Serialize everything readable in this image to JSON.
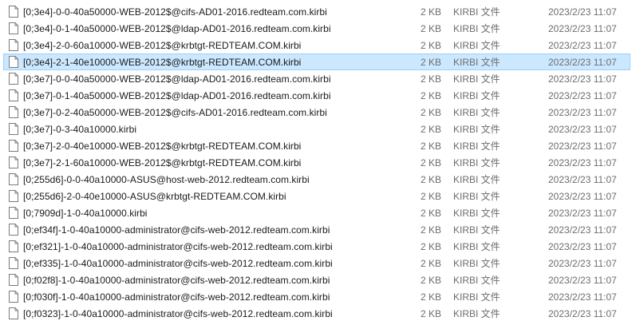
{
  "files": [
    {
      "name": "[0;3e4]-0-0-40a50000-WEB-2012$@cifs-AD01-2016.redteam.com.kirbi",
      "size": "2 KB",
      "type": "KIRBI 文件",
      "date": "2023/2/23 11:07",
      "icon": "document-icon"
    },
    {
      "name": "[0;3e4]-0-1-40a50000-WEB-2012$@ldap-AD01-2016.redteam.com.kirbi",
      "size": "2 KB",
      "type": "KIRBI 文件",
      "date": "2023/2/23 11:07",
      "icon": "document-icon"
    },
    {
      "name": "[0;3e4]-2-0-60a10000-WEB-2012$@krbtgt-REDTEAM.COM.kirbi",
      "size": "2 KB",
      "type": "KIRBI 文件",
      "date": "2023/2/23 11:07",
      "icon": "document-icon"
    },
    {
      "name": "[0;3e4]-2-1-40e10000-WEB-2012$@krbtgt-REDTEAM.COM.kirbi",
      "size": "2 KB",
      "type": "KIRBI 文件",
      "date": "2023/2/23 11:07",
      "icon": "document-icon",
      "selected": true
    },
    {
      "name": "[0;3e7]-0-0-40a50000-WEB-2012$@ldap-AD01-2016.redteam.com.kirbi",
      "size": "2 KB",
      "type": "KIRBI 文件",
      "date": "2023/2/23 11:07",
      "icon": "document-icon"
    },
    {
      "name": "[0;3e7]-0-1-40a50000-WEB-2012$@ldap-AD01-2016.redteam.com.kirbi",
      "size": "2 KB",
      "type": "KIRBI 文件",
      "date": "2023/2/23 11:07",
      "icon": "document-icon"
    },
    {
      "name": "[0;3e7]-0-2-40a50000-WEB-2012$@cifs-AD01-2016.redteam.com.kirbi",
      "size": "2 KB",
      "type": "KIRBI 文件",
      "date": "2023/2/23 11:07",
      "icon": "document-icon"
    },
    {
      "name": "[0;3e7]-0-3-40a10000.kirbi",
      "size": "2 KB",
      "type": "KIRBI 文件",
      "date": "2023/2/23 11:07",
      "icon": "document-icon"
    },
    {
      "name": "[0;3e7]-2-0-40e10000-WEB-2012$@krbtgt-REDTEAM.COM.kirbi",
      "size": "2 KB",
      "type": "KIRBI 文件",
      "date": "2023/2/23 11:07",
      "icon": "document-icon"
    },
    {
      "name": "[0;3e7]-2-1-60a10000-WEB-2012$@krbtgt-REDTEAM.COM.kirbi",
      "size": "2 KB",
      "type": "KIRBI 文件",
      "date": "2023/2/23 11:07",
      "icon": "document-icon"
    },
    {
      "name": "[0;255d6]-0-0-40a10000-ASUS@host-web-2012.redteam.com.kirbi",
      "size": "2 KB",
      "type": "KIRBI 文件",
      "date": "2023/2/23 11:07",
      "icon": "document-icon"
    },
    {
      "name": "[0;255d6]-2-0-40e10000-ASUS@krbtgt-REDTEAM.COM.kirbi",
      "size": "2 KB",
      "type": "KIRBI 文件",
      "date": "2023/2/23 11:07",
      "icon": "document-icon"
    },
    {
      "name": "[0;7909d]-1-0-40a10000.kirbi",
      "size": "2 KB",
      "type": "KIRBI 文件",
      "date": "2023/2/23 11:07",
      "icon": "document-icon"
    },
    {
      "name": "[0;ef34f]-1-0-40a10000-administrator@cifs-web-2012.redteam.com.kirbi",
      "size": "2 KB",
      "type": "KIRBI 文件",
      "date": "2023/2/23 11:07",
      "icon": "document-icon"
    },
    {
      "name": "[0;ef321]-1-0-40a10000-administrator@cifs-web-2012.redteam.com.kirbi",
      "size": "2 KB",
      "type": "KIRBI 文件",
      "date": "2023/2/23 11:07",
      "icon": "document-icon"
    },
    {
      "name": "[0;ef335]-1-0-40a10000-administrator@cifs-web-2012.redteam.com.kirbi",
      "size": "2 KB",
      "type": "KIRBI 文件",
      "date": "2023/2/23 11:07",
      "icon": "document-icon"
    },
    {
      "name": "[0;f02f8]-1-0-40a10000-administrator@cifs-web-2012.redteam.com.kirbi",
      "size": "2 KB",
      "type": "KIRBI 文件",
      "date": "2023/2/23 11:07",
      "icon": "document-icon"
    },
    {
      "name": "[0;f030f]-1-0-40a10000-administrator@cifs-web-2012.redteam.com.kirbi",
      "size": "2 KB",
      "type": "KIRBI 文件",
      "date": "2023/2/23 11:07",
      "icon": "document-icon"
    },
    {
      "name": "[0;f0323]-1-0-40a10000-administrator@cifs-web-2012.redteam.com.kirbi",
      "size": "2 KB",
      "type": "KIRBI 文件",
      "date": "2023/2/23 11:07",
      "icon": "document-icon"
    }
  ],
  "colors": {
    "selection_bg": "#cce8ff",
    "selection_border": "#99d1ff",
    "meta_text": "#6d6d6d"
  }
}
